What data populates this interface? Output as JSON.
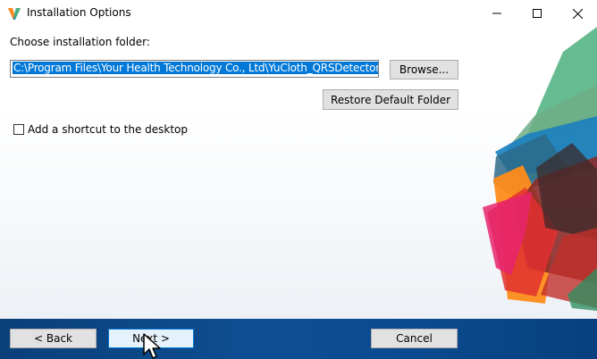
{
  "window": {
    "title": "Installation Options",
    "controls": {
      "minimize": "minimize",
      "maximize": "maximize",
      "close": "close"
    }
  },
  "install": {
    "folder_label": "Choose installation folder:",
    "folder_path": "C:\\Program Files\\Your Health Technology Co., Ltd\\YuCloth_QRSDetector",
    "browse_label": "Browse...",
    "restore_label": "Restore Default Folder",
    "shortcut_label": "Add a shortcut to the desktop",
    "shortcut_checked": false
  },
  "footer": {
    "back_label": "< Back",
    "next_label": "Next >",
    "cancel_label": "Cancel"
  },
  "colors": {
    "selection": "#0078d7",
    "footer": "#0e4f94",
    "deco_green": "#4caf7d",
    "deco_orange": "#ff8c1a",
    "deco_red": "#e03030",
    "deco_pink": "#e8246e",
    "deco_blue": "#1a7fc0",
    "deco_dark": "#3b2a2a"
  },
  "icons": [
    "app-logo-icon",
    "minimize-icon",
    "maximize-icon",
    "close-icon",
    "mouse-cursor-icon"
  ]
}
